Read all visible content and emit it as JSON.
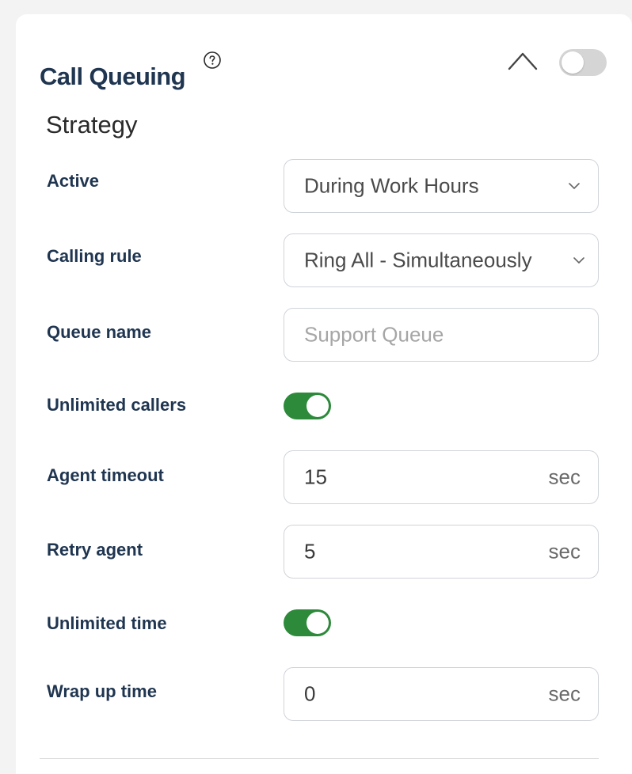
{
  "header": {
    "title": "Call Queuing",
    "help_icon": "help-circle-icon",
    "collapse_icon": "chevron-up-icon",
    "enabled": false
  },
  "strategy": {
    "heading": "Strategy",
    "active": {
      "label": "Active",
      "value": "During Work Hours"
    },
    "calling_rule": {
      "label": "Calling rule",
      "value": "Ring All - Simultaneously"
    },
    "queue_name": {
      "label": "Queue name",
      "placeholder": "Support Queue"
    },
    "unlimited_callers": {
      "label": "Unlimited callers",
      "enabled": true
    },
    "agent_timeout": {
      "label": "Agent timeout",
      "value": "15",
      "unit": "sec"
    },
    "retry_agent": {
      "label": "Retry agent",
      "value": "5",
      "unit": "sec"
    },
    "unlimited_time": {
      "label": "Unlimited time",
      "enabled": true
    },
    "wrap_up_time": {
      "label": "Wrap up time",
      "value": "0",
      "unit": "sec"
    }
  },
  "colors": {
    "title": "#1f3550",
    "toggle_on": "#2d8a3b",
    "toggle_off": "#d5d5d5",
    "field_border": "#cfd3da"
  }
}
